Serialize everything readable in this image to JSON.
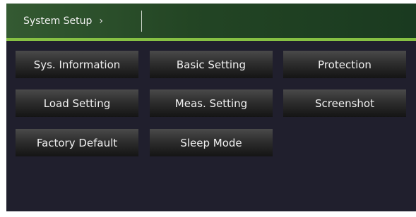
{
  "header": {
    "breadcrumb": "System Setup",
    "chevron": "›",
    "chevron_icon": "chevron-right-icon"
  },
  "menu": {
    "buttons": [
      "Sys. Information",
      "Basic Setting",
      "Protection",
      "Load Setting",
      "Meas. Setting",
      "Screenshot",
      "Factory Default",
      "Sleep Mode"
    ]
  },
  "colors": {
    "background": "#201f2d",
    "header_green": "#2c4f2c",
    "accent_green": "#86c043",
    "button_text": "#f0f0f0"
  }
}
